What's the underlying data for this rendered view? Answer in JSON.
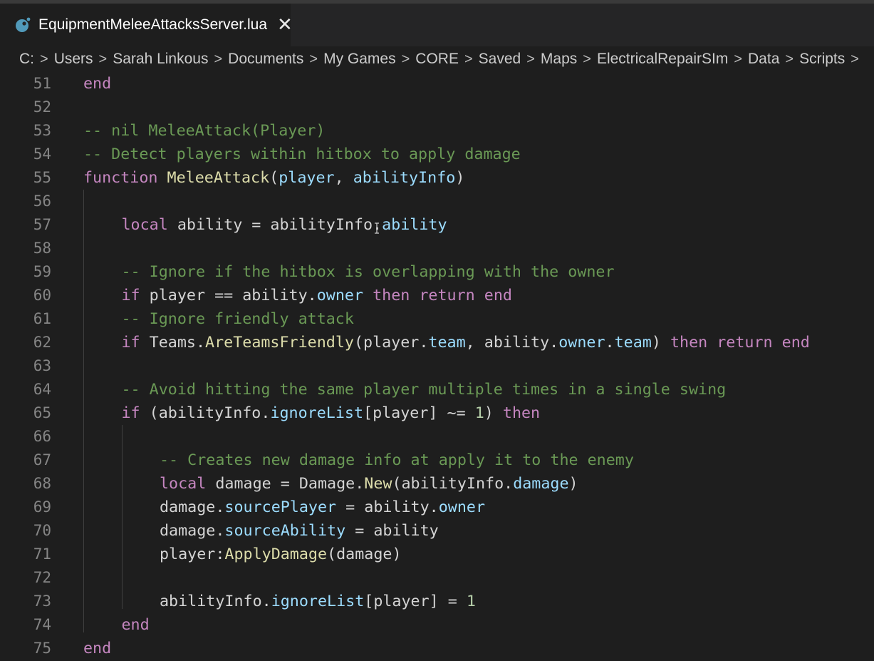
{
  "tab": {
    "title": "EquipmentMeleeAttacksServer.lua",
    "close_glyph": "✕",
    "icon": "lua-file-icon",
    "icon_color": "#519aba"
  },
  "breadcrumb": [
    "C:",
    "Users",
    "Sarah Linkous",
    "Documents",
    "My Games",
    "CORE",
    "Saved",
    "Maps",
    "ElectricalRepairSIm",
    "Data",
    "Scripts"
  ],
  "breadcrumb_separator": ">",
  "colors": {
    "background": "#1e1e1e",
    "keyword": "#c586c0",
    "function": "#dcdcaa",
    "property": "#9cdcfe",
    "comment": "#6a9955",
    "number": "#b5cea8",
    "text": "#d4d4d4",
    "line_number": "#858585"
  },
  "code": {
    "lines": [
      {
        "n": "51",
        "indent": 0,
        "tokens": [
          [
            "kw",
            "end"
          ]
        ]
      },
      {
        "n": "52",
        "indent": 0,
        "tokens": []
      },
      {
        "n": "53",
        "indent": 0,
        "tokens": [
          [
            "cm",
            "-- nil MeleeAttack(Player)"
          ]
        ]
      },
      {
        "n": "54",
        "indent": 0,
        "tokens": [
          [
            "cm",
            "-- Detect players within hitbox to apply damage"
          ]
        ]
      },
      {
        "n": "55",
        "indent": 0,
        "tokens": [
          [
            "kw",
            "function"
          ],
          [
            "id",
            " "
          ],
          [
            "fn",
            "MeleeAttack"
          ],
          [
            "id",
            "("
          ],
          [
            "prop",
            "player"
          ],
          [
            "id",
            ", "
          ],
          [
            "prop",
            "abilityInfo"
          ],
          [
            "id",
            ")"
          ]
        ]
      },
      {
        "n": "56",
        "indent": 0,
        "tokens": []
      },
      {
        "n": "57",
        "indent": 1,
        "tokens": [
          [
            "kw",
            "local"
          ],
          [
            "id",
            " ability = abilityInfo."
          ],
          [
            "prop",
            "ability"
          ]
        ]
      },
      {
        "n": "58",
        "indent": 0,
        "tokens": []
      },
      {
        "n": "59",
        "indent": 1,
        "tokens": [
          [
            "cm",
            "-- Ignore if the hitbox is overlapping with the owner"
          ]
        ]
      },
      {
        "n": "60",
        "indent": 1,
        "tokens": [
          [
            "kw",
            "if"
          ],
          [
            "id",
            " player == ability."
          ],
          [
            "prop",
            "owner"
          ],
          [
            "id",
            " "
          ],
          [
            "kw",
            "then"
          ],
          [
            "id",
            " "
          ],
          [
            "kw",
            "return"
          ],
          [
            "id",
            " "
          ],
          [
            "kw",
            "end"
          ]
        ]
      },
      {
        "n": "61",
        "indent": 1,
        "tokens": [
          [
            "cm",
            "-- Ignore friendly attack"
          ]
        ]
      },
      {
        "n": "62",
        "indent": 1,
        "tokens": [
          [
            "kw",
            "if"
          ],
          [
            "id",
            " Teams."
          ],
          [
            "fn",
            "AreTeamsFriendly"
          ],
          [
            "id",
            "(player."
          ],
          [
            "prop",
            "team"
          ],
          [
            "id",
            ", ability."
          ],
          [
            "prop",
            "owner"
          ],
          [
            "id",
            "."
          ],
          [
            "prop",
            "team"
          ],
          [
            "id",
            ") "
          ],
          [
            "kw",
            "then"
          ],
          [
            "id",
            " "
          ],
          [
            "kw",
            "return"
          ],
          [
            "id",
            " "
          ],
          [
            "kw",
            "end"
          ]
        ]
      },
      {
        "n": "63",
        "indent": 0,
        "tokens": []
      },
      {
        "n": "64",
        "indent": 1,
        "tokens": [
          [
            "cm",
            "-- Avoid hitting the same player multiple times in a single swing"
          ]
        ]
      },
      {
        "n": "65",
        "indent": 1,
        "tokens": [
          [
            "kw",
            "if"
          ],
          [
            "id",
            " (abilityInfo."
          ],
          [
            "prop",
            "ignoreList"
          ],
          [
            "id",
            "[player] ~= "
          ],
          [
            "num",
            "1"
          ],
          [
            "id",
            ") "
          ],
          [
            "kw",
            "then"
          ]
        ]
      },
      {
        "n": "66",
        "indent": 0,
        "tokens": []
      },
      {
        "n": "67",
        "indent": 2,
        "tokens": [
          [
            "cm",
            "-- Creates new damage info at apply it to the enemy"
          ]
        ]
      },
      {
        "n": "68",
        "indent": 2,
        "tokens": [
          [
            "kw",
            "local"
          ],
          [
            "id",
            " damage = Damage."
          ],
          [
            "fn",
            "New"
          ],
          [
            "id",
            "(abilityInfo."
          ],
          [
            "prop",
            "damage"
          ],
          [
            "id",
            ")"
          ]
        ]
      },
      {
        "n": "69",
        "indent": 2,
        "tokens": [
          [
            "id",
            "damage."
          ],
          [
            "prop",
            "sourcePlayer"
          ],
          [
            "id",
            " = ability."
          ],
          [
            "prop",
            "owner"
          ]
        ]
      },
      {
        "n": "70",
        "indent": 2,
        "tokens": [
          [
            "id",
            "damage."
          ],
          [
            "prop",
            "sourceAbility"
          ],
          [
            "id",
            " = ability"
          ]
        ]
      },
      {
        "n": "71",
        "indent": 2,
        "tokens": [
          [
            "id",
            "player:"
          ],
          [
            "fn",
            "ApplyDamage"
          ],
          [
            "id",
            "(damage)"
          ]
        ]
      },
      {
        "n": "72",
        "indent": 0,
        "tokens": []
      },
      {
        "n": "73",
        "indent": 2,
        "tokens": [
          [
            "id",
            "abilityInfo."
          ],
          [
            "prop",
            "ignoreList"
          ],
          [
            "id",
            "[player] = "
          ],
          [
            "num",
            "1"
          ]
        ]
      },
      {
        "n": "74",
        "indent": 1,
        "tokens": [
          [
            "kw",
            "end"
          ]
        ]
      },
      {
        "n": "75",
        "indent": 0,
        "tokens": [
          [
            "kw",
            "end"
          ]
        ]
      }
    ]
  }
}
